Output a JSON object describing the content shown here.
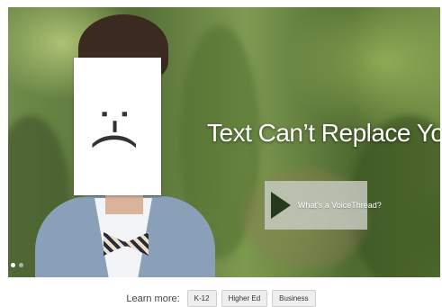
{
  "hero": {
    "emoticon": ":-(",
    "headline": "Text Can’t Replace You",
    "cta_label": "What's a VoiceThread?",
    "slide_count": 2,
    "active_slide": 1
  },
  "learn_more": {
    "label": "Learn more:",
    "buttons": [
      "K-12",
      "Higher Ed",
      "Business"
    ]
  },
  "colors": {
    "cta_play": "#243a1a",
    "headline": "#ffffff"
  },
  "icons": {
    "cta": "play-icon"
  }
}
